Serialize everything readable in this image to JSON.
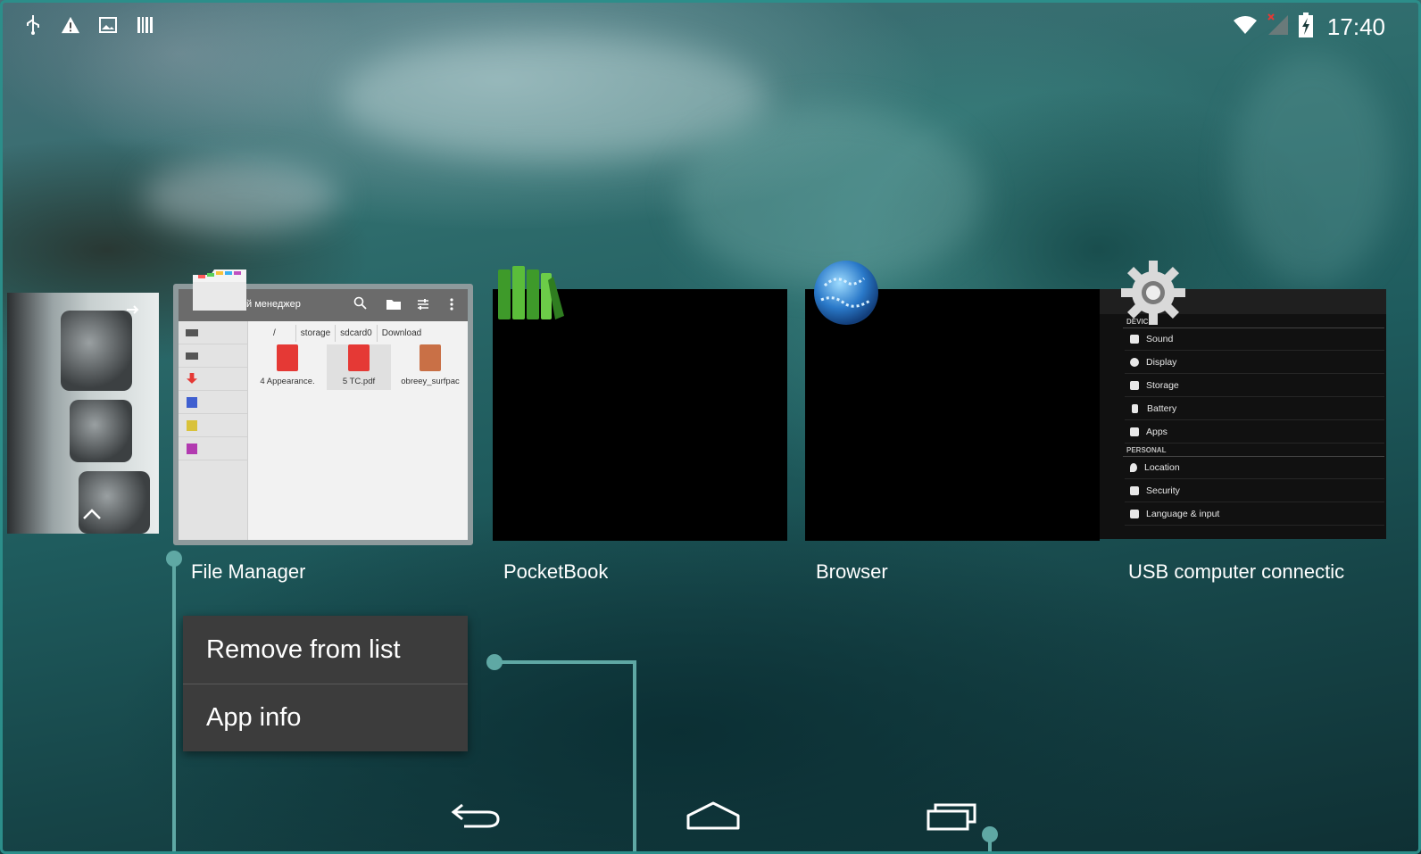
{
  "status_bar": {
    "left_icons": [
      "usb-icon",
      "warning-icon",
      "image-icon",
      "barcode-icon"
    ],
    "right_icons": [
      "wifi-icon",
      "no-signal-icon",
      "battery-charging-icon"
    ],
    "time": "17:40"
  },
  "recents": {
    "cards": [
      {
        "label": "File Manager",
        "icon": "file-manager-icon"
      },
      {
        "label": "PocketBook",
        "icon": "pocketbook-icon"
      },
      {
        "label": "Browser",
        "icon": "browser-globe-icon"
      },
      {
        "label": "USB computer connectic",
        "icon": "settings-gear-icon"
      }
    ],
    "file_manager_preview": {
      "title": "й менеджер",
      "breadcrumbs": [
        "/",
        "storage",
        "sdcard0",
        "Download"
      ],
      "files": [
        "4 Appearance.",
        "5 TC.pdf",
        "obreey_surfpac"
      ]
    },
    "settings_preview": {
      "section_device": "DEVICE",
      "device_items": [
        "Sound",
        "Display",
        "Storage",
        "Battery",
        "Apps"
      ],
      "section_personal": "PERSONAL",
      "personal_items": [
        "Location",
        "Security",
        "Language & input"
      ]
    }
  },
  "context_menu": {
    "items": [
      "Remove from list",
      "App info"
    ]
  },
  "nav_bar": {
    "buttons": [
      "back-icon",
      "home-icon",
      "recent-apps-icon"
    ]
  },
  "colors": {
    "callout": "#5fa8a4",
    "menu_bg": "#3c3c3c",
    "frame": "#2c8e8a"
  }
}
